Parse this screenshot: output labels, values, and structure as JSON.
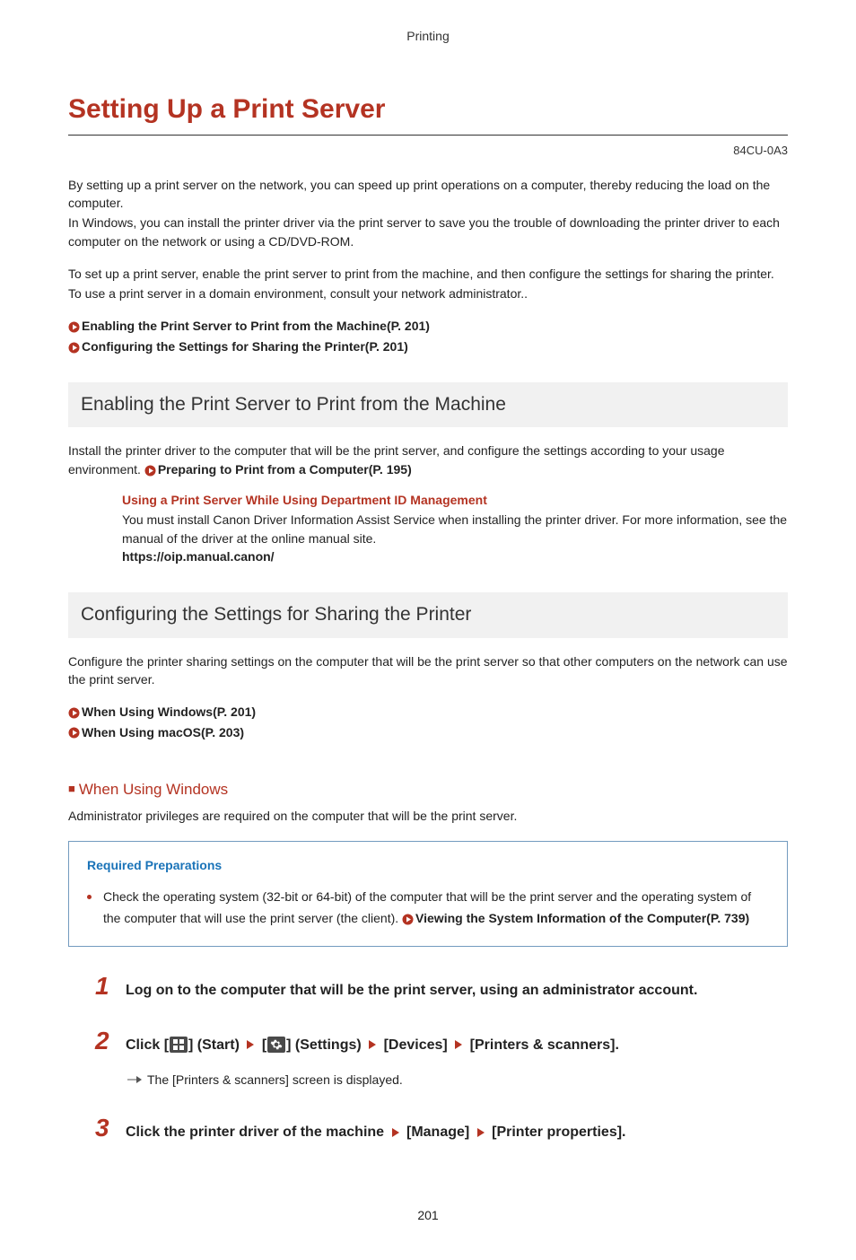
{
  "header": {
    "section": "Printing"
  },
  "title": "Setting Up a Print Server",
  "doc_code": "84CU-0A3",
  "intro": {
    "p1a": "By setting up a print server on the network, you can speed up print operations on a computer, thereby reducing the load on the computer.",
    "p1b": "In Windows, you can install the printer driver via the print server to save you the trouble of downloading the printer driver to each computer on the network or using a CD/DVD-ROM.",
    "p2a": "To set up a print server, enable the print server to print from the machine, and then configure the settings for sharing the printer.",
    "p2b": "To use a print server in a domain environment, consult your network administrator.."
  },
  "intro_links": {
    "l1": "Enabling the Print Server to Print from the Machine(P. 201)",
    "l2": "Configuring the Settings for Sharing the Printer(P. 201)"
  },
  "section1": {
    "title": "Enabling the Print Server to Print from the Machine",
    "text_prefix": "Install the printer driver to the computer that will be the print server, and configure the settings according to your usage environment. ",
    "link": "Preparing to Print from a Computer(P. 195)",
    "note_title": "Using a Print Server While Using Department ID Management",
    "note_body": "You must install Canon Driver Information Assist Service when installing the printer driver. For more information, see the manual of the driver at the online manual site.",
    "note_url": "https://oip.manual.canon/"
  },
  "section2": {
    "title": "Configuring the Settings for Sharing the Printer",
    "text": "Configure the printer sharing settings on the computer that will be the print server so that other computers on the network can use the print server.",
    "links": {
      "l1": "When Using Windows(P. 201)",
      "l2": "When Using macOS(P. 203)"
    }
  },
  "windows": {
    "heading": "When Using Windows",
    "admin_text": "Administrator privileges are required on the computer that will be the print server.",
    "req_title": "Required Preparations",
    "req_text_prefix": "Check the operating system (32-bit or 64-bit) of the computer that will be the print server and the operating system of the computer that will use the print server (the client). ",
    "req_link": "Viewing the System Information of the Computer(P. 739)"
  },
  "steps": {
    "s1": {
      "num": "1",
      "text": "Log on to the computer that will be the print server, using an administrator account."
    },
    "s2": {
      "num": "2",
      "click": "Click [",
      "start": "] (Start)",
      "settings": "] (Settings)",
      "devices": "[Devices]",
      "printers": "[Printers & scanners].",
      "bracket_open": " [",
      "sub": "The [Printers & scanners] screen is displayed."
    },
    "s3": {
      "num": "3",
      "prefix": "Click the printer driver of the machine",
      "manage": "[Manage]",
      "props": "[Printer properties]."
    }
  },
  "page_number": "201"
}
